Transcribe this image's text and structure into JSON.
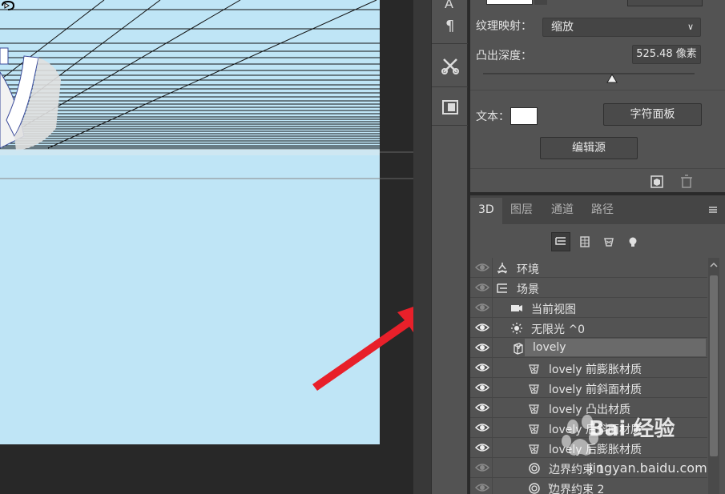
{
  "properties": {
    "texture_mapping_label": "纹理映射：",
    "texture_mapping_value": "缩放",
    "extrusion_depth_label": "凸出深度：",
    "extrusion_depth_value": "525.48 像素",
    "extrusion_depth_fraction": 0.61,
    "text_label": "文本：",
    "char_panel_button": "字符面板",
    "edit_source_button": "编辑源"
  },
  "layers_panel": {
    "tabs": [
      {
        "label": "3D",
        "active": true
      },
      {
        "label": "图层",
        "active": false
      },
      {
        "label": "通道",
        "active": false
      },
      {
        "label": "路径",
        "active": false
      }
    ],
    "items": [
      {
        "label": "环境",
        "icon": "environment-icon",
        "visible": "dim",
        "indent": 0,
        "expander": ""
      },
      {
        "label": "场景",
        "icon": "scene-icon",
        "visible": "dim",
        "indent": 0,
        "expander": ""
      },
      {
        "label": "当前视图",
        "icon": "camera-icon",
        "visible": "dim",
        "indent": 1,
        "expander": ""
      },
      {
        "label": "无限光 ^0",
        "icon": "light-icon",
        "visible": "on",
        "indent": 1,
        "expander": ""
      },
      {
        "label": "lovely",
        "icon": "mesh-icon",
        "visible": "on",
        "indent": 1,
        "expander": "∨",
        "selected": true
      },
      {
        "label": "lovely 前膨胀材质",
        "icon": "material-icon",
        "visible": "on",
        "indent": 2,
        "expander": ""
      },
      {
        "label": "lovely 前斜面材质",
        "icon": "material-icon",
        "visible": "on",
        "indent": 2,
        "expander": ""
      },
      {
        "label": "lovely 凸出材质",
        "icon": "material-icon",
        "visible": "on",
        "indent": 2,
        "expander": ""
      },
      {
        "label": "lovely 后斜面材质",
        "icon": "material-icon",
        "visible": "on",
        "indent": 2,
        "expander": ""
      },
      {
        "label": "lovely 后膨胀材质",
        "icon": "material-icon",
        "visible": "on",
        "indent": 2,
        "expander": ""
      },
      {
        "label": "边界约束 1",
        "icon": "constraint-icon",
        "visible": "dim",
        "indent": 2,
        "expander": ""
      },
      {
        "label": "边界约束 2",
        "icon": "constraint-icon",
        "visible": "dim",
        "indent": 2,
        "expander": "∨"
      }
    ]
  },
  "watermark": {
    "brand": "Bai 经验",
    "url": "jingyan.baidu.com"
  },
  "colors": {
    "canvas_bg": "#bfe5f6",
    "panel_bg": "#535353",
    "arrow": "#e8202a"
  }
}
